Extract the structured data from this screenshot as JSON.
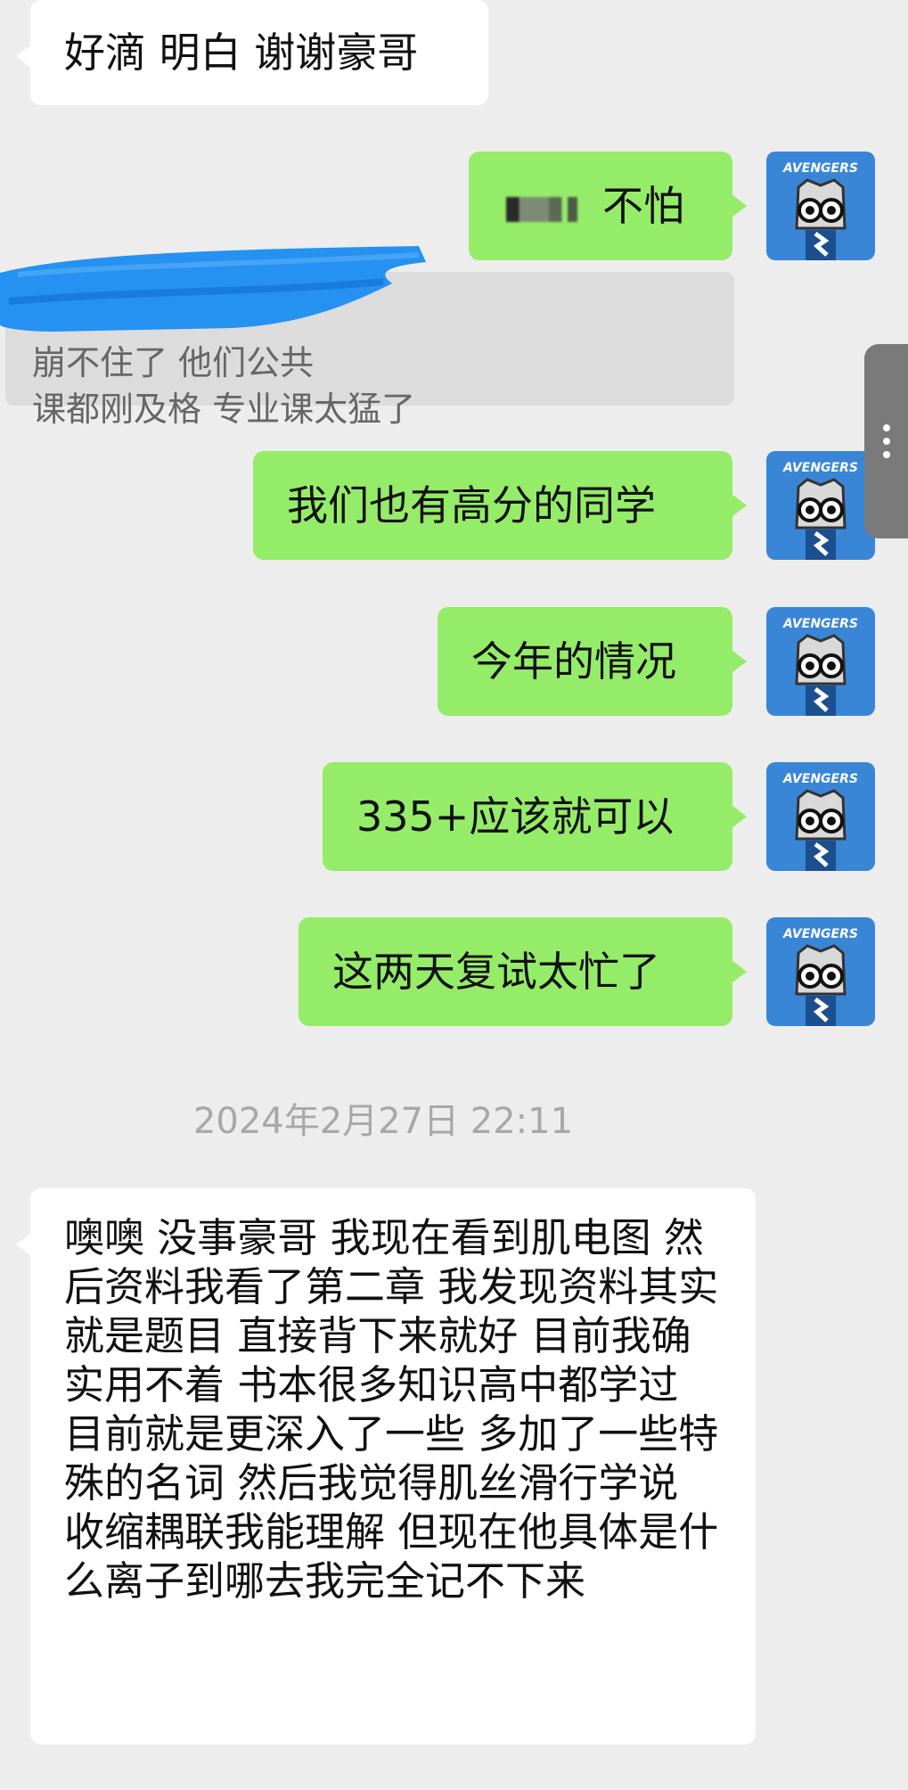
{
  "messages": {
    "incoming_top": "好滴 明白 谢谢豪哥",
    "out_1": "不怕",
    "quote_text": "崩不住了 他们公共\n课都刚及格 专业课太猛了",
    "out_2": "我们也有高分的同学",
    "out_3": "今年的情况",
    "out_4": "335+应该就可以",
    "out_5": "这两天复试太忙了",
    "timestamp": "2024年2月27日 22:11",
    "incoming_long": "噢噢 没事豪哥 我现在看到肌电图 然后资料我看了第二章 我发现资料其实就是题目 直接背下来就好 目前我确实用不着 书本很多知识高中都学过 目前就是更深入了一些 多加了一些特殊的名词 然后我觉得肌丝滑行学说 收缩耦联我能理解 但现在他具体是什么离子到哪去我完全记不下来"
  },
  "avatar": {
    "text": "AVENGERS"
  },
  "colors": {
    "outgoing_bubble": "#95ec69",
    "incoming_bubble": "#ffffff",
    "background": "#ededed"
  },
  "icons": {
    "side_handle": "more-dots-icon"
  }
}
